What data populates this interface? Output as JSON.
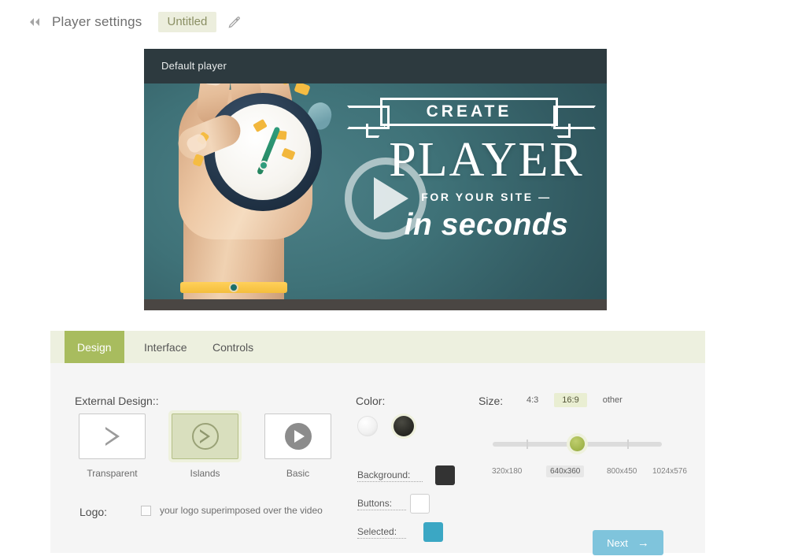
{
  "header": {
    "back_icon": "back-double-chevron",
    "title": "Player settings",
    "project_name": "Untitled",
    "edit_icon": "pencil-icon"
  },
  "preview": {
    "label": "Default player",
    "play_icon": "play-button-icon",
    "poster": {
      "ribbon_text": "CREATE",
      "headline": "PLAYER",
      "subline": "FOR YOUR SITE  —",
      "tagline": "in seconds"
    }
  },
  "tabs": [
    {
      "label": "Design",
      "active": true
    },
    {
      "label": "Interface",
      "active": false
    },
    {
      "label": "Controls",
      "active": false
    }
  ],
  "design": {
    "external_design_label": "External Design::",
    "thumbnails": [
      {
        "label": "Transparent",
        "icon": "play-triangle-outline-icon",
        "selected": false
      },
      {
        "label": "Islands",
        "icon": "play-circle-outline-icon",
        "selected": true
      },
      {
        "label": "Basic",
        "icon": "play-circle-solid-icon",
        "selected": false
      }
    ],
    "logo_label": "Logo:",
    "logo_checkbox_label": "your logo superimposed over the video",
    "logo_checked": false
  },
  "color": {
    "label": "Color:",
    "themes": [
      {
        "name": "light-theme-swatch",
        "selected": false
      },
      {
        "name": "dark-theme-swatch",
        "selected": true
      }
    ],
    "rows": [
      {
        "label": "Background:",
        "value": "#333333"
      },
      {
        "label": "Buttons:",
        "value": "#ffffff"
      },
      {
        "label": "Selected:",
        "value": "#3ba7c4"
      }
    ]
  },
  "size": {
    "label": "Size:",
    "ratios": [
      {
        "label": "4:3",
        "active": false
      },
      {
        "label": "16:9",
        "active": true
      },
      {
        "label": "other",
        "active": false
      }
    ],
    "presets": [
      {
        "label": "320x180",
        "active": false
      },
      {
        "label": "640x360",
        "active": true
      },
      {
        "label": "800x450",
        "active": false
      },
      {
        "label": "1024x576",
        "active": false
      }
    ],
    "selected_index": 1
  },
  "footer": {
    "next_label": "Next",
    "next_arrow": "→"
  },
  "colors": {
    "accent_green": "#a8bc5e",
    "tabbar_bg": "#edf0df",
    "panel_bg": "#f5f5f5",
    "next_blue": "#7fc4dc",
    "project_chip_bg": "#eceedd"
  }
}
